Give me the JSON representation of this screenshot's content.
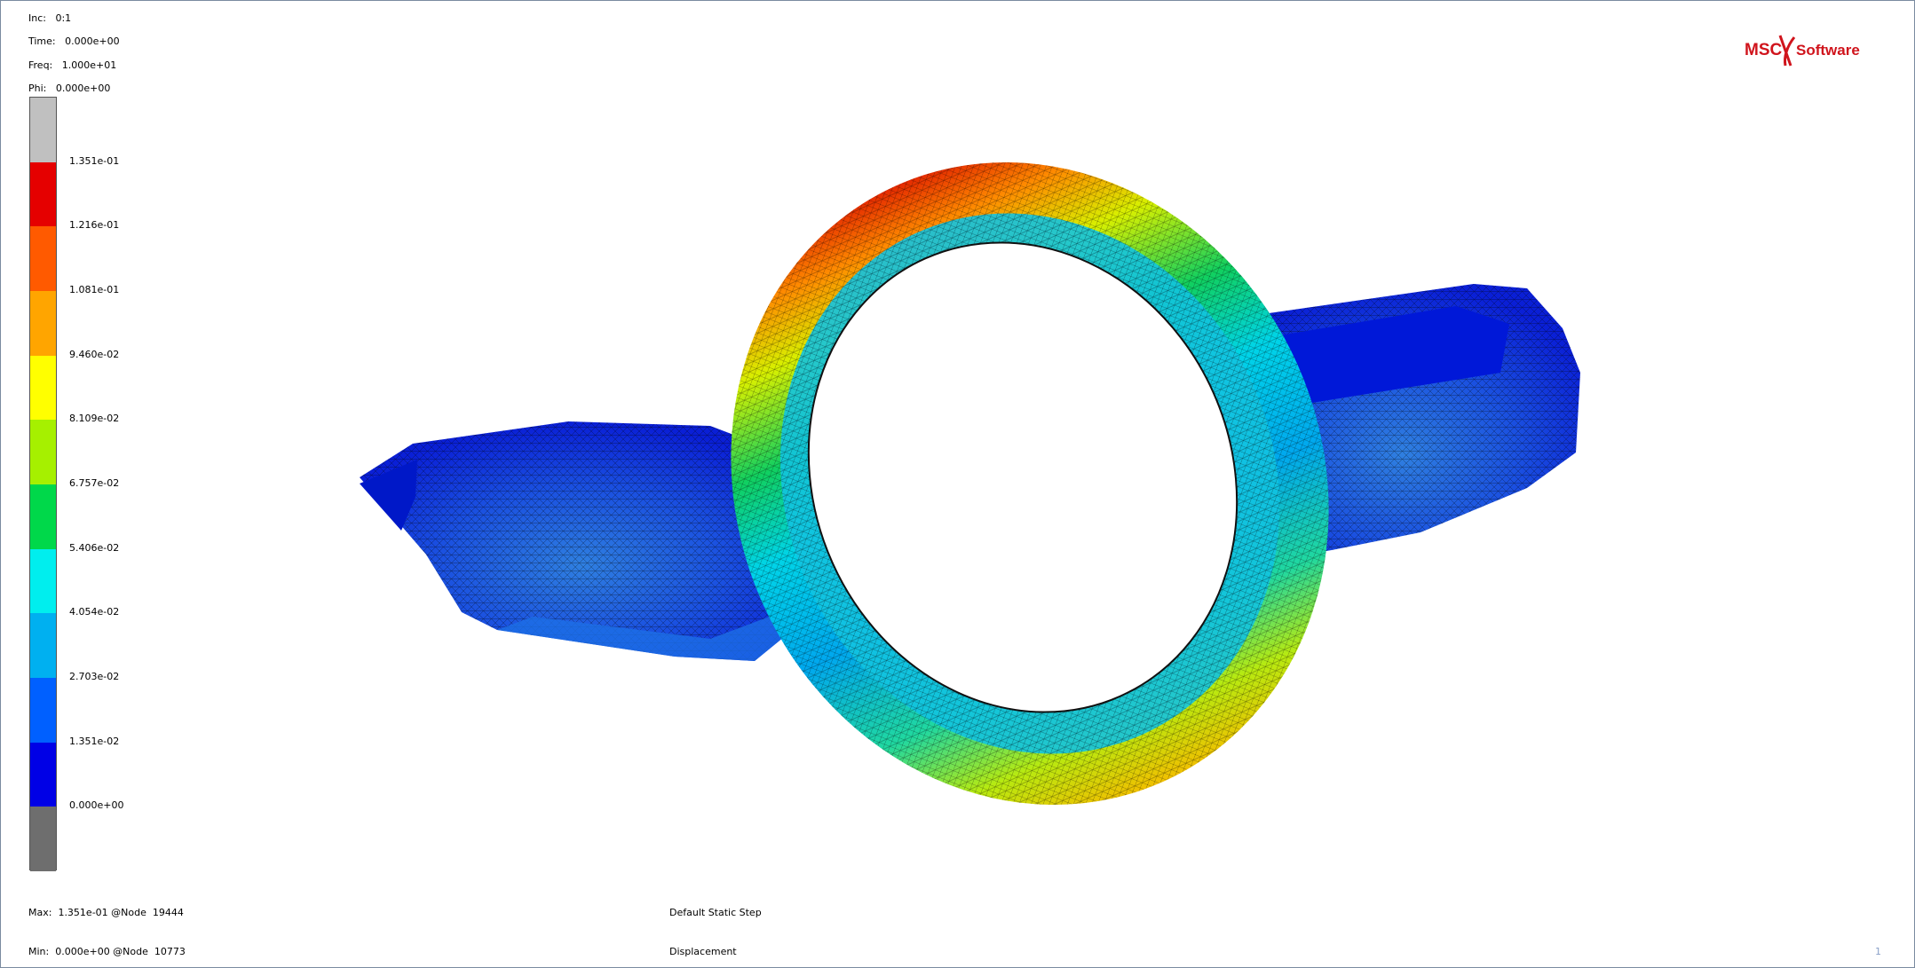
{
  "header_info": {
    "inc": "Inc:   0:1",
    "time": "Time:   0.000e+00",
    "freq": "Freq:   1.000e+01",
    "phi": "Phi:   0.000e+00"
  },
  "legend": {
    "labels": [
      "1.351e-01",
      "1.216e-01",
      "1.081e-01",
      "9.460e-02",
      "8.109e-02",
      "6.757e-02",
      "5.406e-02",
      "4.054e-02",
      "2.703e-02",
      "1.351e-02",
      "0.000e+00"
    ],
    "colors": [
      "#c0c0c0",
      "#e50000",
      "#ff5a00",
      "#ffa500",
      "#ffff00",
      "#a6f000",
      "#00d84a",
      "#00eeee",
      "#00b0f0",
      "#0060ff",
      "#0000e6",
      "#6e6e6e"
    ]
  },
  "footer": {
    "max": "Max:  1.351e-01 @Node  19444",
    "min": "Min:  0.000e+00 @Node  10773",
    "step": "Default Static Step",
    "result": "Displacement",
    "corner": "1"
  },
  "logo": {
    "left_text": "MSC",
    "right_text": "Software",
    "color": "#d0141c"
  }
}
